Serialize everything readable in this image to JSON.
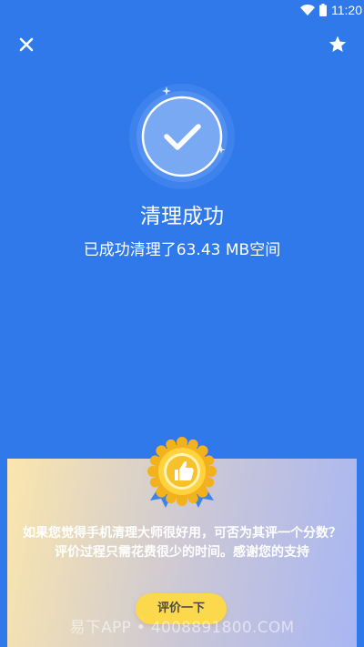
{
  "status_bar": {
    "time": "11:20",
    "icons": [
      "wifi-icon",
      "battery-icon"
    ]
  },
  "toolbar": {
    "close_icon": "close-icon",
    "favorite_icon": "star-icon"
  },
  "result": {
    "icon": "checkmark-icon",
    "title": "清理成功",
    "description": "已成功清理了63.43 MB空间"
  },
  "rating_card": {
    "medal_icon": "thumbs-up-medal-icon",
    "message": "如果您觉得手机清理大师很好用，可否为其评一个分数？评价过程只需花费很少的时间。感谢您的支持",
    "button_label": "评价一下"
  },
  "watermark": "易下APP • 4008891800.COM",
  "colors": {
    "background": "#2f79ea",
    "button": "#fbd84c",
    "card_gradient_start": "#fbe6ad",
    "card_gradient_end": "#a8b6f3"
  }
}
